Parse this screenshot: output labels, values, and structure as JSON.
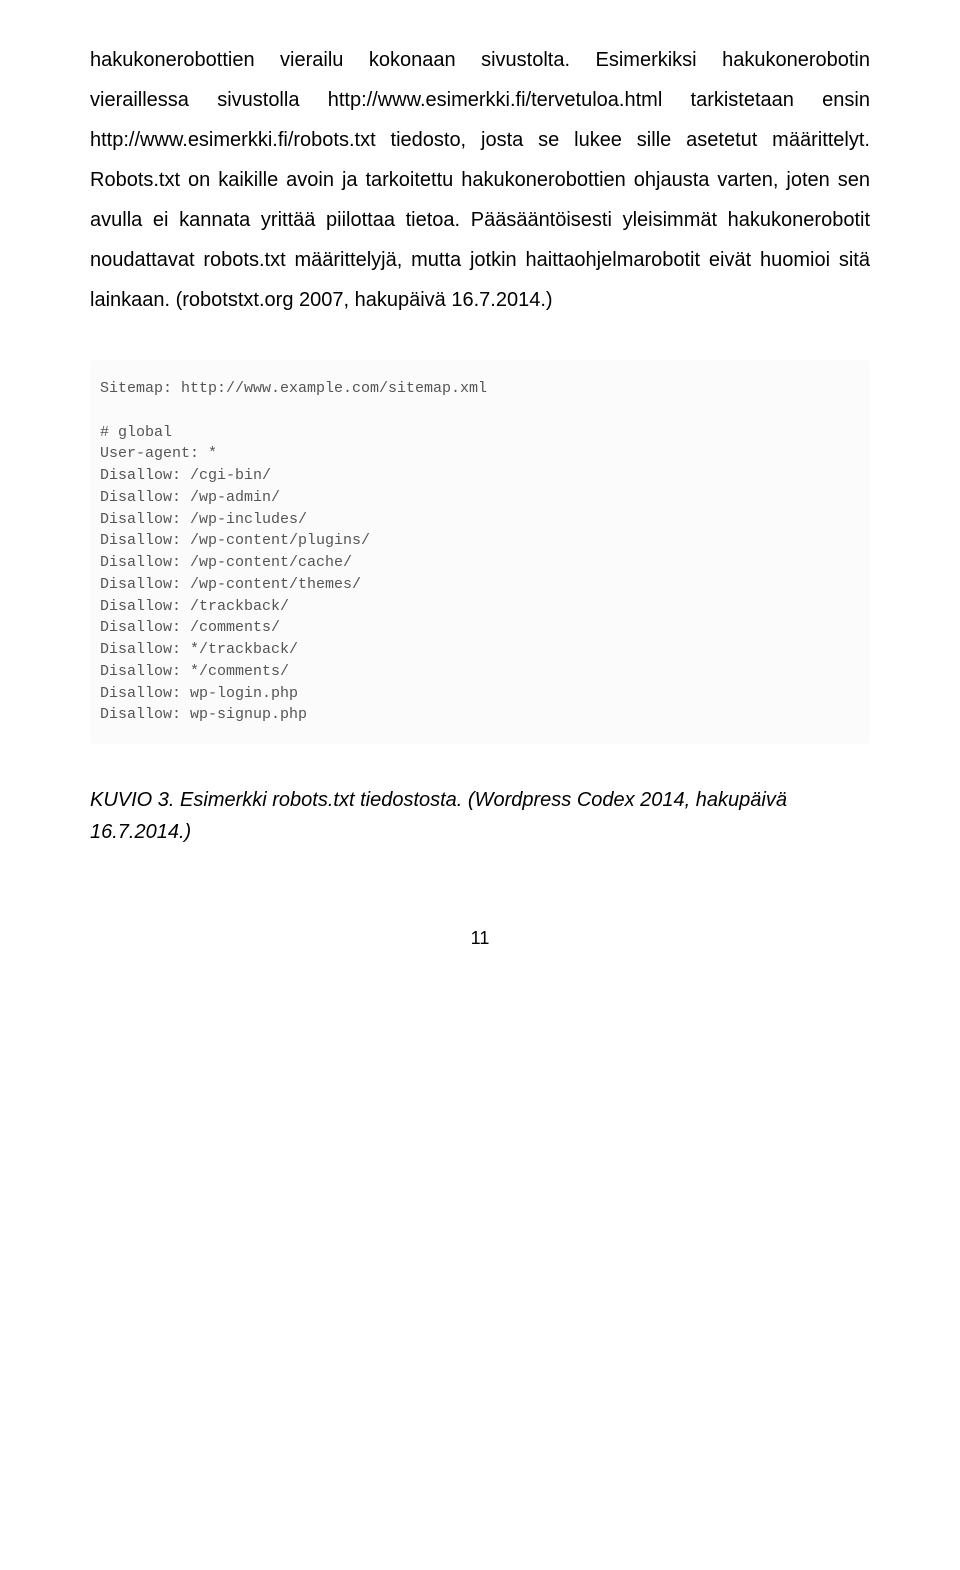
{
  "paragraph": "hakukonerobottien vierailu kokonaan sivustolta. Esimerkiksi hakukonerobotin vieraillessa sivustolla http://www.esimerkki.fi/tervetuloa.html tarkistetaan ensin http://www.esimerkki.fi/robots.txt tiedosto, josta se lukee sille asetetut määrittelyt. Robots.txt on kaikille avoin ja tarkoitettu hakukonerobottien ohjausta varten, joten sen avulla ei kannata yrittää piilottaa tietoa. Pääsääntöisesti yleisimmät hakukonerobotit noudattavat robots.txt määrittelyjä, mutta jotkin haittaohjelmarobotit eivät huomioi sitä lainkaan. (robotstxt.org 2007, hakupäivä 16.7.2014.)",
  "code": "Sitemap: http://www.example.com/sitemap.xml\n\n# global\nUser-agent: *\nDisallow: /cgi-bin/\nDisallow: /wp-admin/\nDisallow: /wp-includes/\nDisallow: /wp-content/plugins/\nDisallow: /wp-content/cache/\nDisallow: /wp-content/themes/\nDisallow: /trackback/\nDisallow: /comments/\nDisallow: */trackback/\nDisallow: */comments/\nDisallow: wp-login.php\nDisallow: wp-signup.php",
  "caption": "KUVIO 3. Esimerkki robots.txt tiedostosta. (Wordpress Codex 2014, hakupäivä 16.7.2014.)",
  "page_number": "11"
}
